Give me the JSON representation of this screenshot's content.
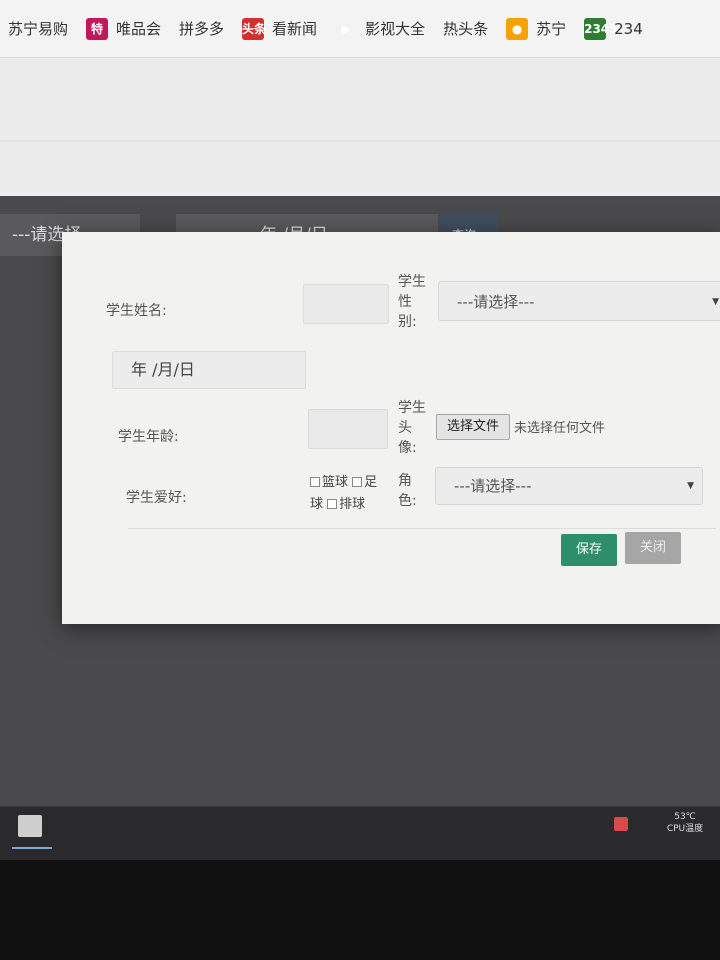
{
  "bookmarks": [
    {
      "label": "苏宁易购",
      "icon": "",
      "icon_name": "none"
    },
    {
      "label": "唯品会",
      "icon": "特",
      "icon_name": "vip-icon"
    },
    {
      "label": "拼多多",
      "icon": "",
      "icon_name": "none"
    },
    {
      "label": "看新闻",
      "icon": "头条",
      "icon_name": "news-icon"
    },
    {
      "label": "影视大全",
      "icon": "▶",
      "icon_name": "play-icon"
    },
    {
      "label": "热头条",
      "icon": "",
      "icon_name": "none"
    },
    {
      "label": "苏宁",
      "icon": "●",
      "icon_name": "suning-icon"
    },
    {
      "label": "234",
      "icon": "2345",
      "icon_name": "2345-icon"
    }
  ],
  "background": {
    "filter_select": "---请选择",
    "filter_date": "年 /月/日",
    "filter_button": "查询"
  },
  "modal": {
    "name_label": "学生姓名:",
    "name_value": "",
    "gender_label": "学生性别:",
    "gender_select": "---请选择---",
    "date_value": "年 /月/日",
    "age_label": "学生年龄:",
    "age_value": "",
    "avatar_label": "学生头像:",
    "file_button": "选择文件",
    "file_status": "未选择任何文件",
    "hobby_label": "学生爱好:",
    "hobbies": [
      "篮球",
      "足球",
      "排球"
    ],
    "role_label": "角色:",
    "role_select": "---请选择---",
    "save_button": "保存",
    "close_button": "关闭"
  },
  "taskbar": {
    "temp_value": "53℃",
    "temp_label": "CPU温度"
  },
  "colors": {
    "save_button": "#2c8f6a",
    "close_button": "#a6a6a6",
    "overlay": "#4a4a4c"
  }
}
